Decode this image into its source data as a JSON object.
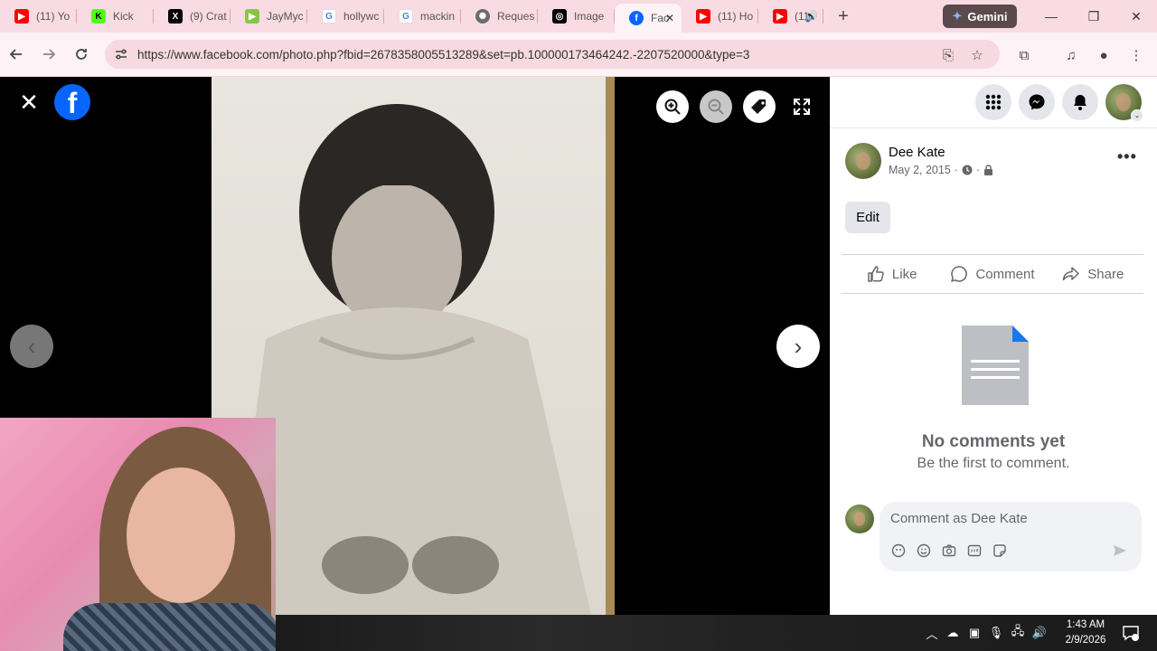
{
  "browser": {
    "tabs": [
      {
        "title": "(11) Yo",
        "icon": "youtube-icon",
        "color": "#ff0000"
      },
      {
        "title": "Kick",
        "icon": "kick-icon",
        "color": "#53fc18"
      },
      {
        "title": "(9) Crat",
        "icon": "x-icon",
        "color": "#000000"
      },
      {
        "title": "JayMyc",
        "icon": "rumble-icon",
        "color": "#85c742"
      },
      {
        "title": "hollywc",
        "icon": "google-icon",
        "color": "#4285f4"
      },
      {
        "title": "mackin",
        "icon": "google-icon",
        "color": "#4285f4"
      },
      {
        "title": "Reques",
        "icon": "openai-icon",
        "color": "#6b6b6b"
      },
      {
        "title": "Image",
        "icon": "image-gen-icon",
        "color": "#000000"
      },
      {
        "title": "Fac",
        "icon": "facebook-icon",
        "color": "#0866ff",
        "active": true
      },
      {
        "title": "(11) Ho",
        "icon": "youtube-icon",
        "color": "#ff0000"
      },
      {
        "title": "(11",
        "icon": "youtube-icon",
        "color": "#ff0000"
      }
    ],
    "new_tab": "+",
    "gemini_label": "Gemini",
    "url": "https://www.facebook.com/photo.php?fbid=2678358005513289&set=pb.100000173464242.-2207520000&type=3"
  },
  "viewer": {
    "close": "✕",
    "logo": "f"
  },
  "panel": {
    "poster_name": "Dee Kate",
    "post_date": "May 2, 2015",
    "meta_sep": "·",
    "more": "•••",
    "edit_label": "Edit",
    "actions": {
      "like": "Like",
      "comment": "Comment",
      "share": "Share"
    },
    "no_comments_title": "No comments yet",
    "no_comments_sub": "Be the first to comment.",
    "comment_placeholder": "Comment as Dee Kate"
  },
  "taskbar": {
    "time": "1:43 AM",
    "date": "2/9/2026"
  },
  "colors": {
    "facebook_blue": "#0866ff",
    "tabstrip_bg": "#f9dbe3",
    "toolbar_bg": "#fdf2f5"
  }
}
